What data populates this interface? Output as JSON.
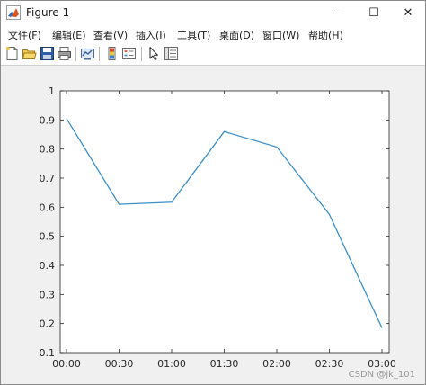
{
  "window": {
    "title": "Figure 1",
    "minimize_glyph": "—",
    "maximize_glyph": "☐",
    "close_glyph": "✕"
  },
  "menu": {
    "items": [
      "文件(F)",
      "编辑(E)",
      "查看(V)",
      "插入(I)",
      "工具(T)",
      "桌面(D)",
      "窗口(W)",
      "帮助(H)"
    ]
  },
  "toolbar": {
    "icons": [
      "new-figure-icon",
      "open-file-icon",
      "save-icon",
      "print-icon",
      "link-plot-icon",
      "insert-colorbar-icon",
      "insert-legend-icon",
      "edit-plot-pointer-icon",
      "property-inspector-icon"
    ]
  },
  "colors": {
    "line": "#3a8fc8",
    "axes": "#262626",
    "background": "#f0f0f0",
    "plot_background": "#ffffff"
  },
  "chart_data": {
    "type": "line",
    "x": [
      "00:00",
      "00:30",
      "01:00",
      "01:30",
      "02:00",
      "02:30",
      "03:00"
    ],
    "series": [
      {
        "values": [
          0.905,
          0.61,
          0.617,
          0.86,
          0.807,
          0.575,
          0.185
        ]
      }
    ],
    "yticks": [
      "0.1",
      "0.2",
      "0.3",
      "0.4",
      "0.5",
      "0.6",
      "0.7",
      "0.8",
      "0.9",
      "1"
    ],
    "ylim": [
      0.1,
      1
    ],
    "grid": false,
    "title": "",
    "xlabel": "",
    "ylabel": ""
  },
  "watermark": "CSDN @jk_101"
}
